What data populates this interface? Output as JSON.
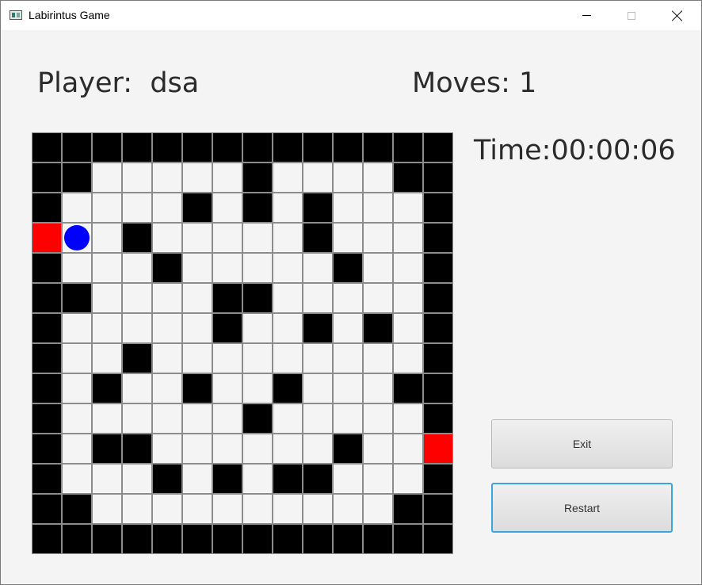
{
  "window": {
    "title": "Labirintus Game"
  },
  "header": {
    "player_label": "Player:  dsa",
    "moves_label": "Moves: 1"
  },
  "timer": {
    "label": "Time:00:00:06"
  },
  "maze": {
    "legend": {
      "W": "wall",
      "P": "path",
      "D": "door",
      "B": "player"
    },
    "colors": {
      "wall": "#000000",
      "path": "#f4f4f4",
      "door": "#ff0000",
      "player": "#0000ff"
    },
    "rows": [
      "WWWWWWWWWWWWWW",
      "WWPPPPPWPPPPWW",
      "WPPPPWPWPWPPPW",
      "DBPWPPPPPWPPPW",
      "WPPPWPPPPPWPPW",
      "WWPPPPWWPPPPPW",
      "WPPPPPWPPWPWPW",
      "WPPWPPPPPPPPPW",
      "WPWPPWPPWPPPWW",
      "WPPPPPPWPPPPPW",
      "WPWWPPPPPPWPPD",
      "WPPPWPWPWWPPPW",
      "WWPPPPPPPPPPWW",
      "WWWWWWWWWWWWWW"
    ]
  },
  "buttons": {
    "exit_label": "Exit",
    "restart_label": "Restart"
  }
}
